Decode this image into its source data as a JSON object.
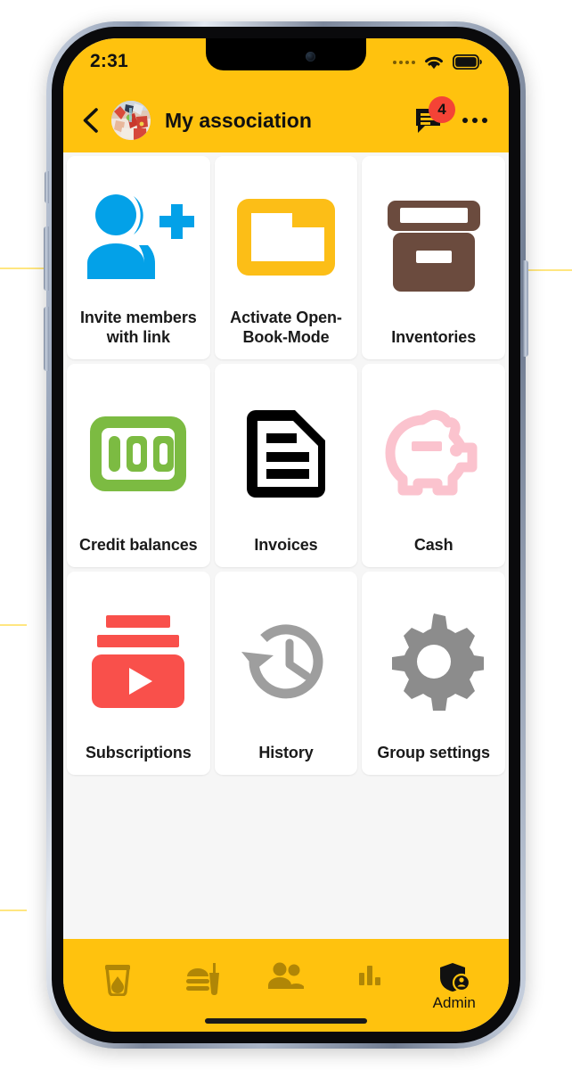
{
  "status_bar": {
    "time": "2:31",
    "signal_icon": "signal-dots-icon",
    "wifi_icon": "wifi-icon",
    "battery_icon": "battery-full-icon"
  },
  "header": {
    "back_icon": "back-chevron-icon",
    "avatar_icon": "group-avatar-photo",
    "title": "My association",
    "chat_icon": "chat-bubble-icon",
    "chat_badge_count": "4",
    "overflow_icon": "more-options-icon"
  },
  "grid": {
    "tiles": [
      {
        "label": "Invite members with link",
        "icon": "person-add-icon",
        "color": "#03A1E8"
      },
      {
        "label": "Activate Open-Book-Mode",
        "icon": "folder-icon",
        "color": "#FCBE17"
      },
      {
        "label": "Inventories",
        "icon": "archive-box-icon",
        "color": "#6B4B3E"
      },
      {
        "label": "Credit balances",
        "icon": "hundred-credits-icon",
        "color": "#7CBB42"
      },
      {
        "label": "Invoices",
        "icon": "invoice-document-icon",
        "color": "#000000"
      },
      {
        "label": "Cash",
        "icon": "piggy-bank-icon",
        "color": "#FBC3CE"
      },
      {
        "label": "Subscriptions",
        "icon": "subscriptions-play-icon",
        "color": "#F9504B"
      },
      {
        "label": "History",
        "icon": "history-clock-icon",
        "color": "#9E9E9E"
      },
      {
        "label": "Group settings",
        "icon": "gear-icon",
        "color": "#8C8C8C"
      }
    ]
  },
  "bottom_nav": {
    "items": [
      {
        "label": "",
        "icon": "drink-cup-icon",
        "active": false
      },
      {
        "label": "",
        "icon": "food-meal-icon",
        "active": false
      },
      {
        "label": "",
        "icon": "people-group-icon",
        "active": false
      },
      {
        "label": "",
        "icon": "bar-chart-icon",
        "active": false
      },
      {
        "label": "Admin",
        "icon": "admin-shield-icon",
        "active": true
      }
    ]
  },
  "colors": {
    "brand_yellow": "#FFC20E",
    "nav_inactive": "#B08606",
    "badge_red": "#F44336",
    "page_bg": "#F6F6F6"
  }
}
